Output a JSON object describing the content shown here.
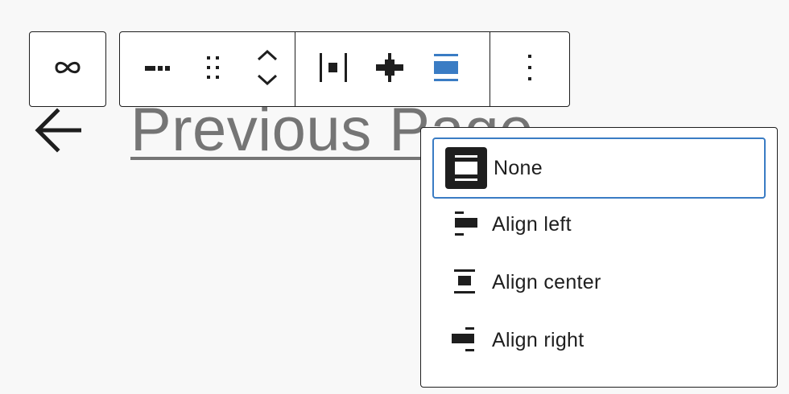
{
  "page": {
    "link_text": "Previous Page"
  },
  "toolbar": {
    "parent": {
      "icon": "link-icon"
    },
    "buttons": [
      {
        "icon": "separator-icon"
      },
      {
        "icon": "drag-handle-icon"
      },
      {
        "icon": "move-up-down-icon"
      },
      {
        "icon": "justify-space-between-icon"
      },
      {
        "icon": "justify-center-icon"
      },
      {
        "icon": "align-none-icon"
      },
      {
        "icon": "more-options-icon"
      }
    ]
  },
  "dropdown": {
    "items": [
      {
        "label": "None",
        "icon": "align-none-icon",
        "selected": true
      },
      {
        "label": "Align left",
        "icon": "align-left-icon",
        "selected": false
      },
      {
        "label": "Align center",
        "icon": "align-center-icon",
        "selected": false
      },
      {
        "label": "Align right",
        "icon": "align-right-icon",
        "selected": false
      }
    ]
  },
  "colors": {
    "accent": "#3a7cc4",
    "text": "#1e1e1e",
    "link": "#757575",
    "background": "#f8f8f8"
  }
}
